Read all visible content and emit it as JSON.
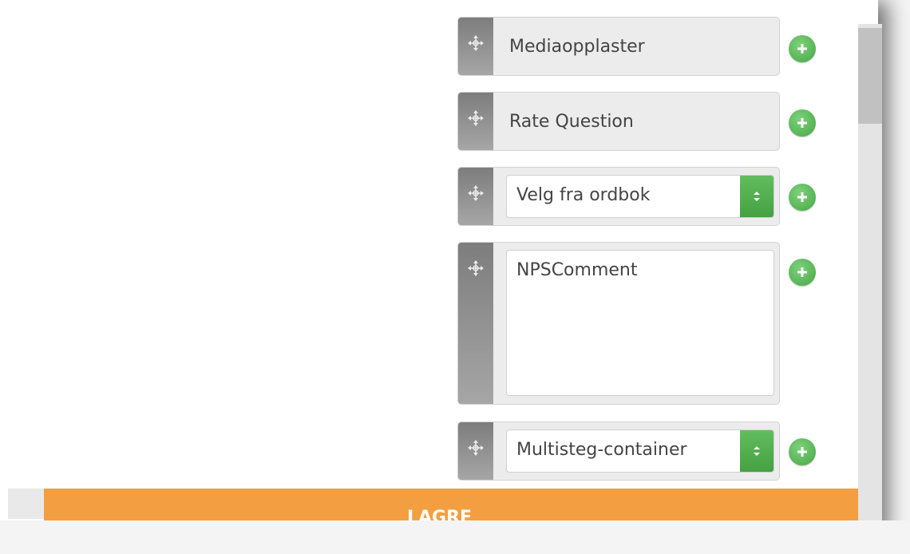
{
  "widgets": [
    {
      "kind": "button",
      "label": "Mediaopplaster"
    },
    {
      "kind": "button",
      "label": "Rate Question"
    },
    {
      "kind": "select",
      "value": "Velg fra ordbok"
    },
    {
      "kind": "textarea",
      "value": "NPSComment"
    },
    {
      "kind": "select",
      "value": "Multisteg-container"
    }
  ],
  "footer_bar": {
    "label": "LAGRE"
  },
  "colors": {
    "accent_green": "#4cae4a",
    "footer_orange": "#f39f41",
    "handle_gray": "#8e8e8e"
  },
  "icons": {
    "handle": "move-icon",
    "add": "plus-circle-icon",
    "select": "up-down-chevron-icon"
  }
}
